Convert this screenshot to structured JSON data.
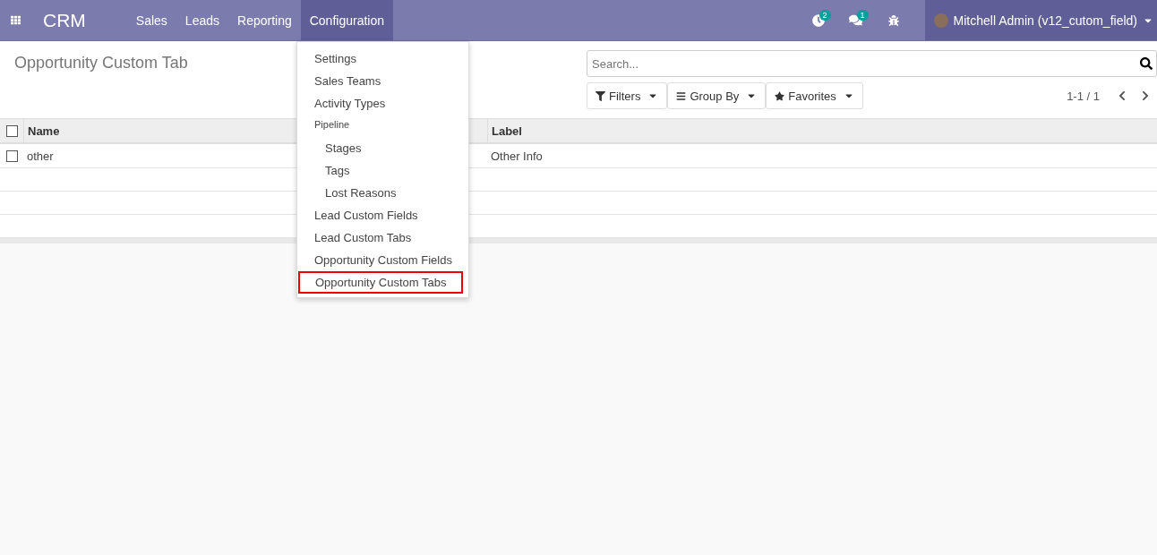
{
  "navbar": {
    "app_name": "CRM",
    "menus": [
      {
        "label": "Sales",
        "selected": false
      },
      {
        "label": "Leads",
        "selected": false
      },
      {
        "label": "Reporting",
        "selected": false
      },
      {
        "label": "Configuration",
        "selected": true
      }
    ],
    "activity_count": "2",
    "message_count": "1",
    "user": "Mitchell Admin (v12_cutom_field)"
  },
  "dropdown": {
    "items": [
      {
        "kind": "item",
        "label": "Settings",
        "highlighted": false
      },
      {
        "kind": "item",
        "label": "Sales Teams",
        "highlighted": false
      },
      {
        "kind": "item",
        "label": "Activity Types",
        "highlighted": false
      },
      {
        "kind": "header",
        "label": "Pipeline",
        "highlighted": false
      },
      {
        "kind": "subitem",
        "label": "Stages",
        "highlighted": false
      },
      {
        "kind": "subitem",
        "label": "Tags",
        "highlighted": false
      },
      {
        "kind": "subitem",
        "label": "Lost Reasons",
        "highlighted": false
      },
      {
        "kind": "item",
        "label": "Lead Custom Fields",
        "highlighted": false
      },
      {
        "kind": "item",
        "label": "Lead Custom Tabs",
        "highlighted": false
      },
      {
        "kind": "item",
        "label": "Opportunity Custom Fields",
        "highlighted": false
      },
      {
        "kind": "item",
        "label": "Opportunity Custom Tabs",
        "highlighted": true
      }
    ]
  },
  "breadcrumb": "Opportunity Custom Tab",
  "search": {
    "placeholder": "Search..."
  },
  "filters": [
    "Filters",
    "Group By",
    "Favorites"
  ],
  "pager": "1-1 / 1",
  "table": {
    "header_checked": false,
    "columns": [
      "Name",
      "Label"
    ],
    "rows": [
      {
        "checked": false,
        "cells": [
          "other",
          "Other Info"
        ]
      }
    ]
  }
}
